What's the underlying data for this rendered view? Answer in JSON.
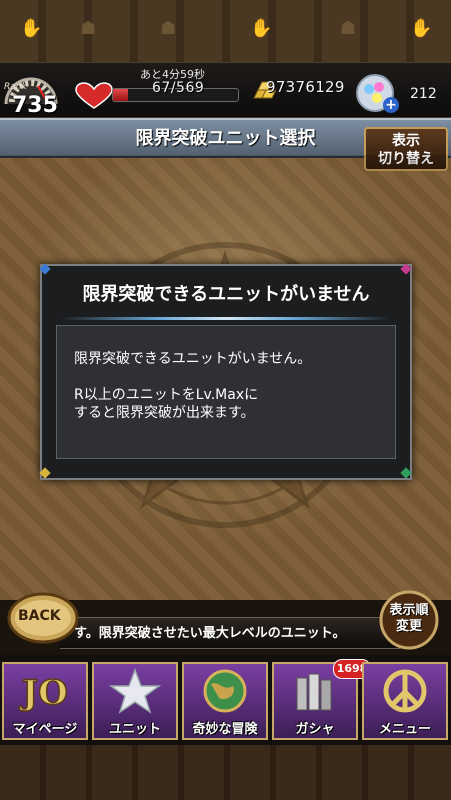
{
  "status": {
    "rank_word": "Rank",
    "rank": "735",
    "timer_label": "あと4分59秒",
    "stamina": "67/569",
    "stamina_fraction": 0.118,
    "money": "97376129",
    "gems": "212"
  },
  "header": {
    "title": "限界突破ユニット選択",
    "toggle_label_line1": "表示",
    "toggle_label_line2": "切り替え"
  },
  "dialog": {
    "title": "限界突破できるユニットがいません",
    "message_line1": "限界突破できるユニットがいません。",
    "message_line2": "R以上のユニットをLv.Maxに",
    "message_line3": "すると限界突破が出来ます。"
  },
  "lower": {
    "back_label": "BACK",
    "ticker": "す。限界突破させたい最大レベルのユニット。",
    "sort_label_line1": "表示順",
    "sort_label_line2": "変更"
  },
  "nav": {
    "items": [
      {
        "label": "マイページ",
        "icon": "jo-logo-icon"
      },
      {
        "label": "ユニット",
        "icon": "star-stack-icon"
      },
      {
        "label": "奇妙な冒険",
        "icon": "globe-icon"
      },
      {
        "label": "ガシャ",
        "icon": "bundle-icon"
      },
      {
        "label": "メニュー",
        "icon": "peace-icon"
      }
    ],
    "gacha_badge": "1698"
  },
  "colors": {
    "accent_gold": "#c7a769",
    "nav_purple": "#7b3fa3",
    "title_blue": "#7d8fa2",
    "dialog_bg": "#1c1d1f"
  }
}
